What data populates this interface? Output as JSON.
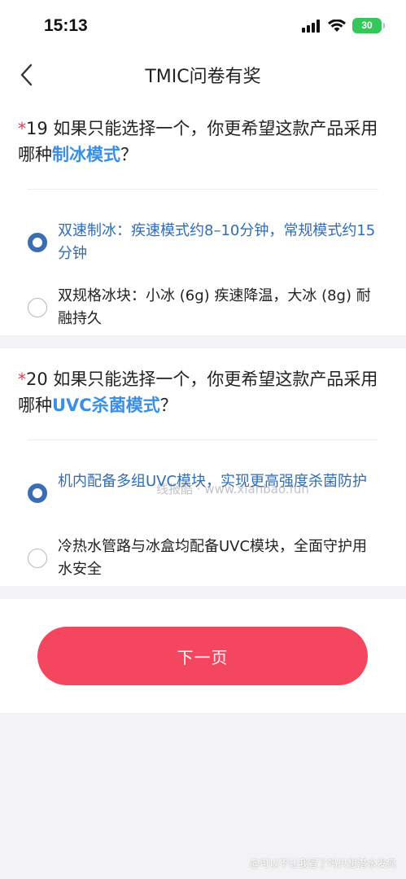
{
  "status_bar": {
    "time": "15:13",
    "battery": "30"
  },
  "nav": {
    "title": "TMIC问卷有奖"
  },
  "questions": [
    {
      "required_mark": "*",
      "text_prefix": "19 如果只能选择一个，你更希望这款产品采用哪种",
      "highlight": "制冰模式",
      "text_suffix": "？",
      "options": [
        {
          "label": "双速制冰：疾速模式约8–10分钟，常规模式约15分钟",
          "selected": true
        },
        {
          "label": "双规格冰块：小冰 (6g) 疾速降温，大冰 (8g) 耐融持久",
          "selected": false
        }
      ]
    },
    {
      "required_mark": "*",
      "text_prefix": "20 如果只能选择一个，你更希望这款产品采用哪种",
      "highlight": "UVC杀菌模式",
      "text_suffix": "？",
      "options": [
        {
          "label": "机内配备多组UVC模块，实现更高强度杀菌防护",
          "selected": true
        },
        {
          "label": "冷热水管路与冰盒均配备UVC模块，全面守护用水安全",
          "selected": false
        }
      ]
    }
  ],
  "next_button": {
    "label": "下一页"
  },
  "watermarks": {
    "middle": "线报酷 · www.xianbao.fun",
    "bottom": "@可以不让我冒了吗只想潜水发疯"
  },
  "colors": {
    "accent_blue": "#3a8ee6",
    "radio_selected": "#3b6db3",
    "button": "#f5465f",
    "required": "#e8384f",
    "battery": "#35c759"
  }
}
